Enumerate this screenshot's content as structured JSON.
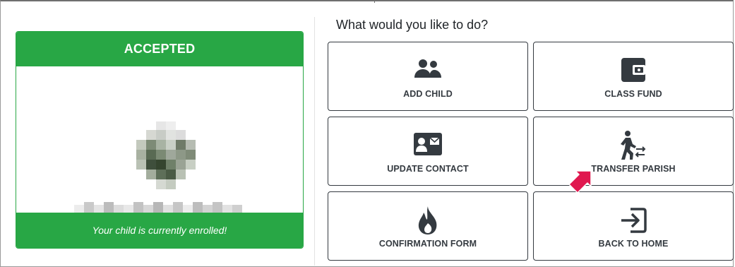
{
  "status": {
    "title": "ACCEPTED",
    "message": "Your child is currently enrolled!",
    "color": "#28a745"
  },
  "actions_prompt": "What would you like to do?",
  "actions": [
    {
      "label": "ADD CHILD",
      "icon": "users-icon"
    },
    {
      "label": "CLASS FUND",
      "icon": "wallet-icon"
    },
    {
      "label": "UPDATE CONTACT",
      "icon": "contact-card-icon"
    },
    {
      "label": "TRANSFER PARISH",
      "icon": "walking-transfer-icon"
    },
    {
      "label": "CONFIRMATION FORM",
      "icon": "flame-icon"
    },
    {
      "label": "BACK TO HOME",
      "icon": "sign-in-icon"
    }
  ],
  "colors": {
    "accent_green": "#28a745",
    "icon_dark": "#343a40",
    "pointer_arrow": "#e0184f"
  }
}
